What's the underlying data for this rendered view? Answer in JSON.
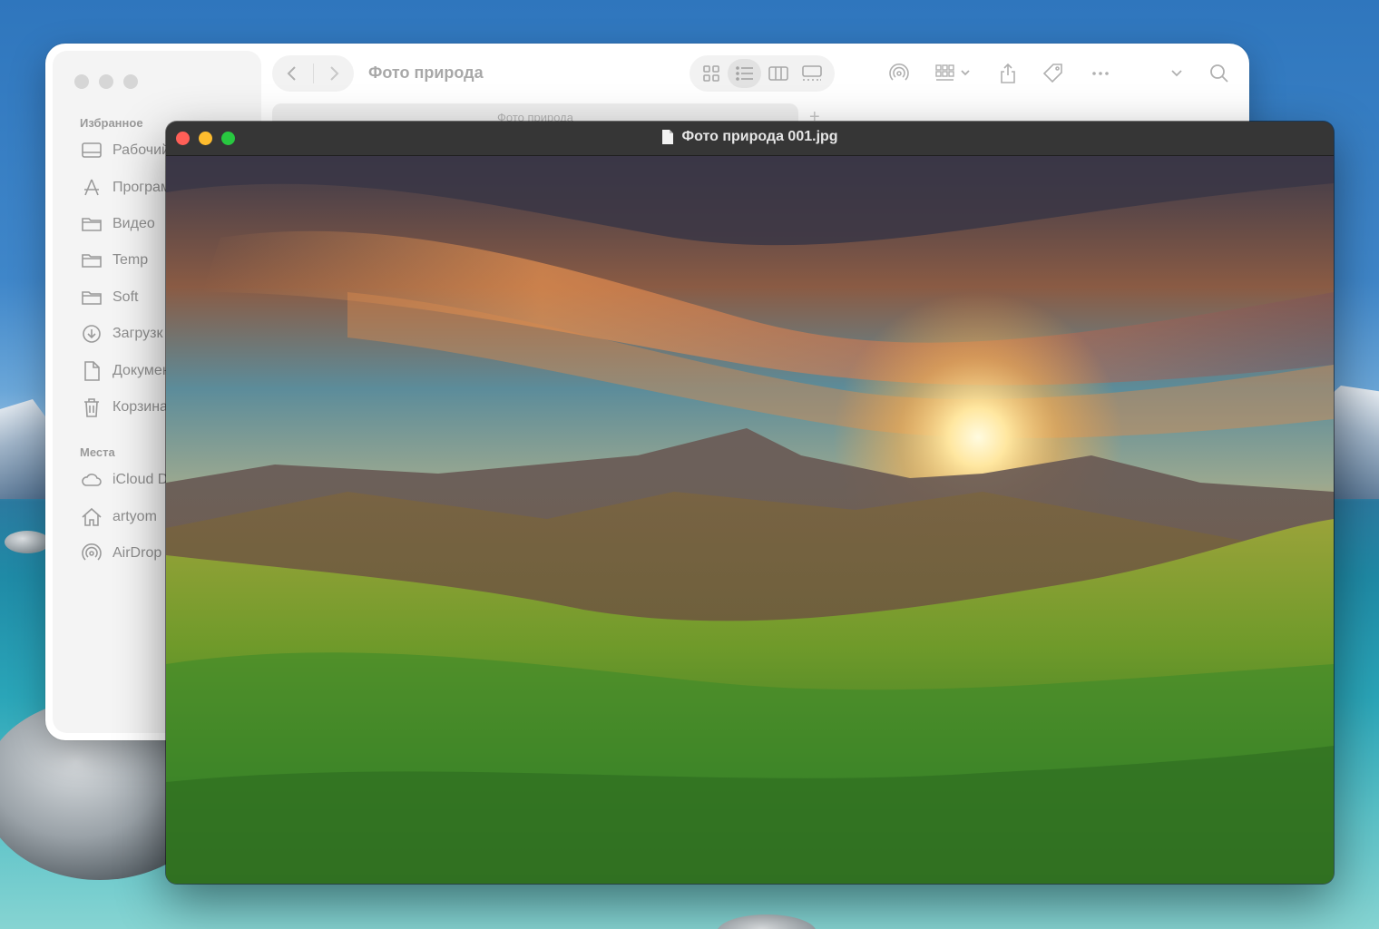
{
  "desktop": {
    "background": "ocean-wallpaper"
  },
  "finder": {
    "title": "Фото природа",
    "tab_label": "Фото природа",
    "tab_add_label": "+",
    "sidebar": {
      "favorites_heading": "Избранное",
      "favorites": [
        {
          "label": "Рабочий",
          "icon": "desktop-icon"
        },
        {
          "label": "Програм",
          "icon": "applications-icon"
        },
        {
          "label": "Видео",
          "icon": "folder-icon"
        },
        {
          "label": "Temp",
          "icon": "folder-icon"
        },
        {
          "label": "Soft",
          "icon": "folder-icon"
        },
        {
          "label": "Загрузк",
          "icon": "download-icon"
        },
        {
          "label": "Докумен",
          "icon": "document-icon"
        },
        {
          "label": "Корзина",
          "icon": "trash-icon"
        }
      ],
      "places_heading": "Места",
      "places": [
        {
          "label": "iCloud D",
          "icon": "icloud-icon"
        },
        {
          "label": "artyom",
          "icon": "home-icon"
        },
        {
          "label": "AirDrop",
          "icon": "airdrop-icon"
        }
      ]
    },
    "toolbar_icons": [
      "back-icon",
      "forward-icon",
      "grid-view-icon",
      "list-view-icon",
      "column-view-icon",
      "gallery-view-icon",
      "airdrop-icon",
      "group-icon",
      "share-icon",
      "tag-icon",
      "more-icon",
      "chevron-down-icon",
      "search-icon"
    ],
    "active_view": "list"
  },
  "preview": {
    "title": "Фото природа 001.jpg",
    "title_icon": "document-icon",
    "traffic_colors": {
      "close": "#ff5f57",
      "minimize": "#febc2e",
      "zoom": "#28c840"
    },
    "image": "mountain sunset over green grass"
  }
}
